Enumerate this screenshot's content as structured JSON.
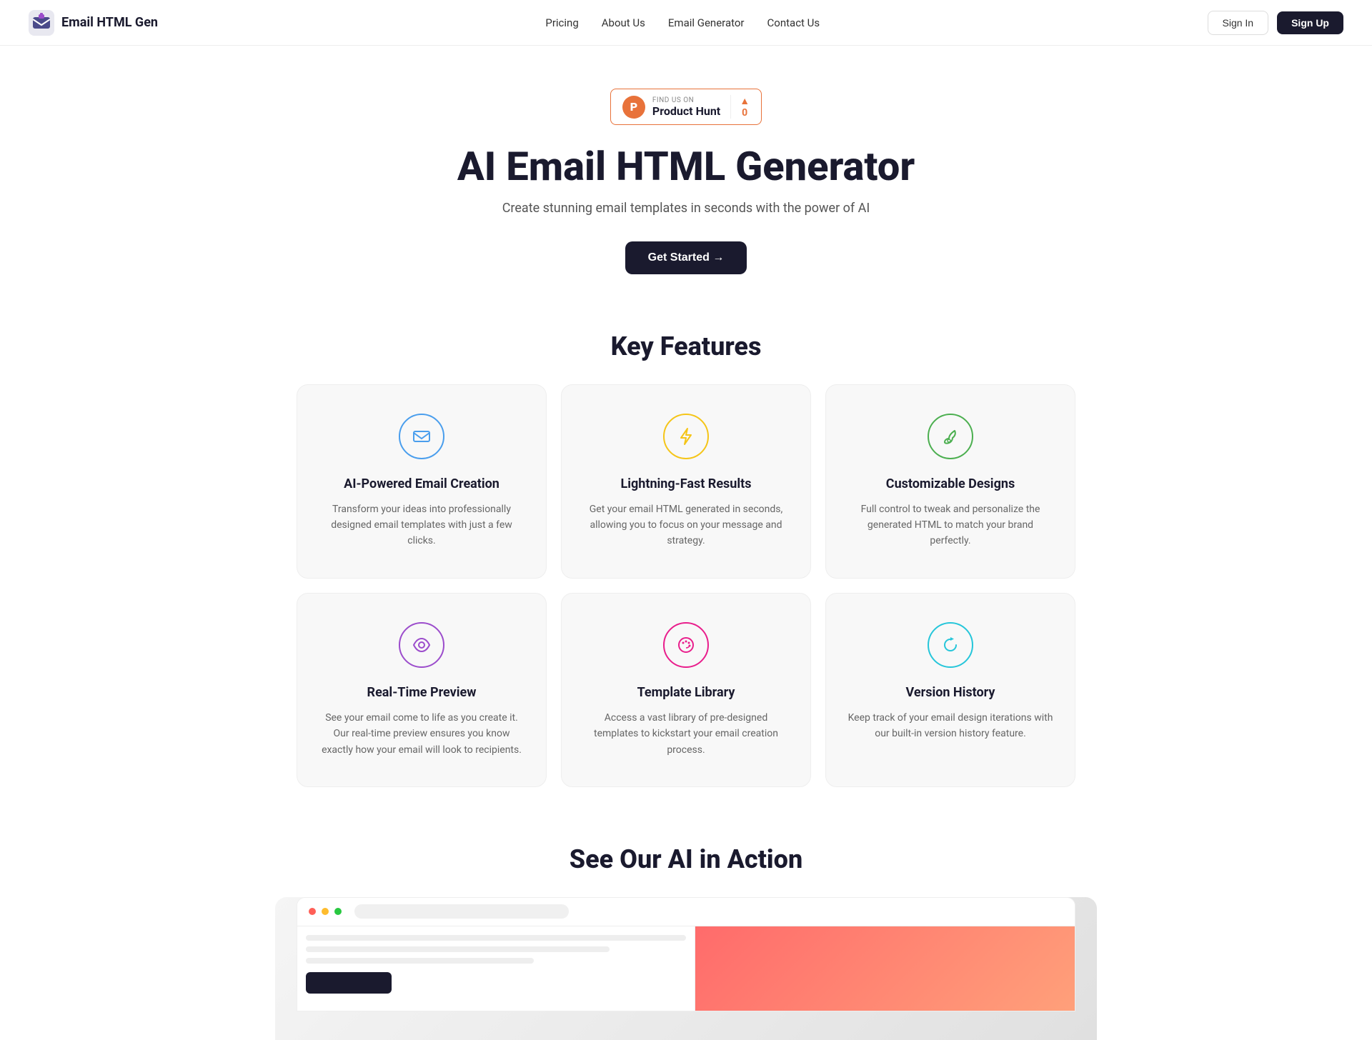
{
  "brand": {
    "name": "Email HTML Gen",
    "logo_alt": "Email HTML Gen logo"
  },
  "nav": {
    "links": [
      {
        "id": "pricing",
        "label": "Pricing",
        "href": "#pricing"
      },
      {
        "id": "about",
        "label": "About Us",
        "href": "#about"
      },
      {
        "id": "generator",
        "label": "Email Generator",
        "href": "#generator"
      },
      {
        "id": "contact",
        "label": "Contact Us",
        "href": "#contact"
      }
    ],
    "signin_label": "Sign In",
    "signup_label": "Sign Up"
  },
  "product_hunt": {
    "find_us_label": "FIND US ON",
    "name": "Product Hunt",
    "vote_count": "0"
  },
  "hero": {
    "title": "AI Email HTML Generator",
    "subtitle": "Create stunning email templates in seconds with the power of AI",
    "cta_label": "Get Started →"
  },
  "features_section": {
    "title": "Key Features",
    "features": [
      {
        "id": "ai-email-creation",
        "icon": "mail",
        "icon_color": "blue",
        "title": "AI-Powered Email Creation",
        "description": "Transform your ideas into professionally designed email templates with just a few clicks."
      },
      {
        "id": "lightning-fast",
        "icon": "zap",
        "icon_color": "yellow",
        "title": "Lightning-Fast Results",
        "description": "Get your email HTML generated in seconds, allowing you to focus on your message and strategy."
      },
      {
        "id": "customizable",
        "icon": "brush",
        "icon_color": "green",
        "title": "Customizable Designs",
        "description": "Full control to tweak and personalize the generated HTML to match your brand perfectly."
      },
      {
        "id": "realtime-preview",
        "icon": "eye",
        "icon_color": "purple",
        "title": "Real-Time Preview",
        "description": "See your email come to life as you create it. Our real-time preview ensures you know exactly how your email will look to recipients."
      },
      {
        "id": "template-library",
        "icon": "palette",
        "icon_color": "pink",
        "title": "Template Library",
        "description": "Access a vast library of pre-designed templates to kickstart your email creation process."
      },
      {
        "id": "version-history",
        "icon": "refresh",
        "icon_color": "teal",
        "title": "Version History",
        "description": "Keep track of your email design iterations with our built-in version history feature."
      }
    ]
  },
  "ai_action_section": {
    "title": "See Our AI in Action"
  },
  "colors": {
    "brand_dark": "#1a1a2e",
    "accent_orange": "#e8723a",
    "blue": "#4a9eed",
    "yellow": "#f5c518",
    "green": "#4caf50",
    "purple": "#9c4dcc",
    "pink": "#e91e8c",
    "teal": "#26c6da"
  }
}
